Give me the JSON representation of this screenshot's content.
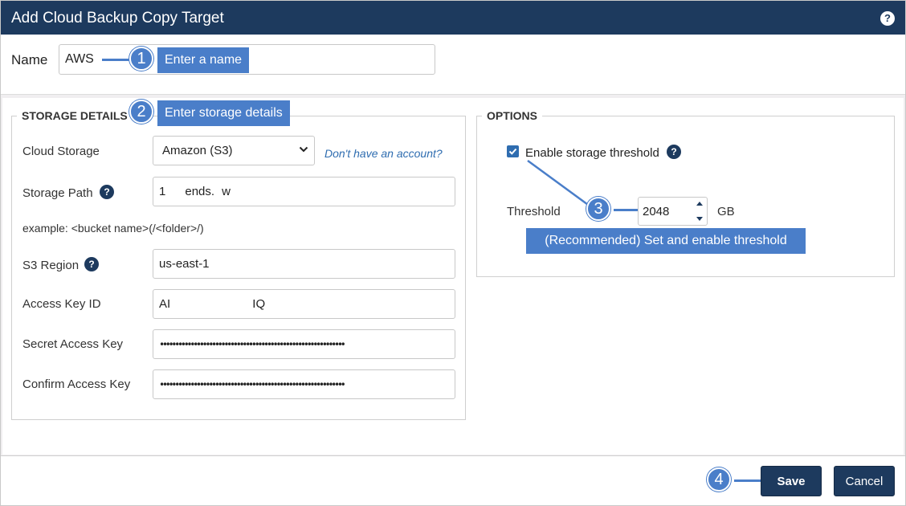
{
  "dialog": {
    "title": "Add Cloud Backup Copy Target",
    "help_icon": "question-circle-icon",
    "help_glyph": "?"
  },
  "name_row": {
    "label": "Name",
    "value": "AWS"
  },
  "storage": {
    "legend": "STORAGE DETAILS",
    "cloud_storage_label": "Cloud Storage",
    "cloud_storage_value": "Amazon (S3)",
    "account_link": "Don't have an account?",
    "storage_path_label": "Storage Path",
    "storage_path_value": "1        ends.   w",
    "example_text": "example: <bucket name>(/<folder>/)",
    "s3_region_label": "S3 Region",
    "s3_region_value": "us-east-1",
    "access_key_label": "Access Key ID",
    "access_key_value": "AI                                  IQ",
    "secret_key_label": "Secret Access Key",
    "secret_key_value": "••••••••••••••••••••••••••••••••••••••••••••••••••••••••••••",
    "confirm_key_label": "Confirm Access Key",
    "confirm_key_value": "••••••••••••••••••••••••••••••••••••••••••••••••••••••••••••",
    "help_glyph": "?"
  },
  "options": {
    "legend": "OPTIONS",
    "enable_threshold_label": "Enable storage threshold",
    "enable_threshold_checked": true,
    "threshold_label": "Threshold",
    "threshold_value": "2048",
    "threshold_unit": "GB",
    "help_glyph": "?"
  },
  "callouts": [
    {
      "number": "1",
      "text": "Enter a name"
    },
    {
      "number": "2",
      "text": "Enter storage details"
    },
    {
      "number": "3",
      "text": "(Recommended) Set and enable threshold"
    },
    {
      "number": "4",
      "text": ""
    }
  ],
  "footer": {
    "save_label": "Save",
    "cancel_label": "Cancel"
  },
  "colors": {
    "titlebar": "#1d3a5e",
    "accent": "#4a7ec9",
    "link": "#2f6db0"
  }
}
